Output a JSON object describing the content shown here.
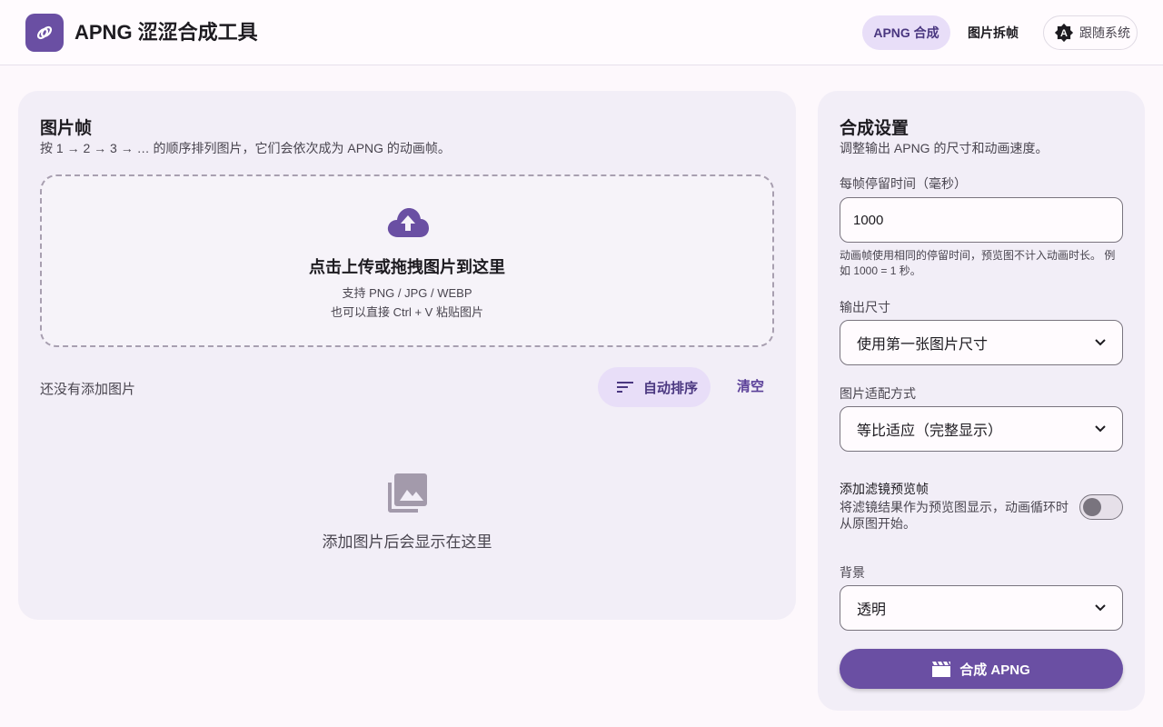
{
  "header": {
    "app_title": "APNG 涩涩合成工具",
    "tabs": [
      {
        "label": "APNG 合成",
        "active": true
      },
      {
        "label": "图片拆帧",
        "active": false
      }
    ],
    "theme_button": {
      "icon": "auto-theme-icon",
      "label": "跟随系统"
    }
  },
  "frames_panel": {
    "title": "图片帧",
    "subtitle": "按 1 → 2 → 3 → … 的顺序排列图片，它们会依次成为 APNG 的动画帧。",
    "dropzone": {
      "icon": "cloud-upload-icon",
      "title": "点击上传或拖拽图片到这里",
      "formats": "支持 PNG / JPG / WEBP",
      "paste_hint": "也可以直接 Ctrl + V 粘贴图片"
    },
    "status": "还没有添加图片",
    "sort_button": {
      "icon": "sort-icon",
      "label": "自动排序"
    },
    "clear_button": "清空",
    "empty_state": {
      "icon": "image-collection-icon",
      "text": "添加图片后会显示在这里"
    }
  },
  "settings_panel": {
    "title": "合成设置",
    "subtitle": "调整输出 APNG 的尺寸和动画速度。",
    "frame_delay": {
      "label": "每帧停留时间（毫秒）",
      "value": "1000",
      "helper": "动画帧使用相同的停留时间，预览图不计入动画时长。 例如 1000 = 1 秒。"
    },
    "output_size": {
      "label": "输出尺寸",
      "selected": "使用第一张图片尺寸"
    },
    "fit_mode": {
      "label": "图片适配方式",
      "selected": "等比适应（完整显示）"
    },
    "filter_preview": {
      "title": "添加滤镜预览帧",
      "description": "将滤镜结果作为预览图显示，动画循环时从原图开始。",
      "enabled": false
    },
    "background": {
      "label": "背景",
      "selected": "透明"
    },
    "compose_button": {
      "icon": "clapperboard-icon",
      "label": "合成 APNG"
    }
  },
  "colors": {
    "primary": "#6a4fa3",
    "tonal": "#e8def8",
    "surface": "#f2eef7",
    "background": "#fdf8fc"
  }
}
